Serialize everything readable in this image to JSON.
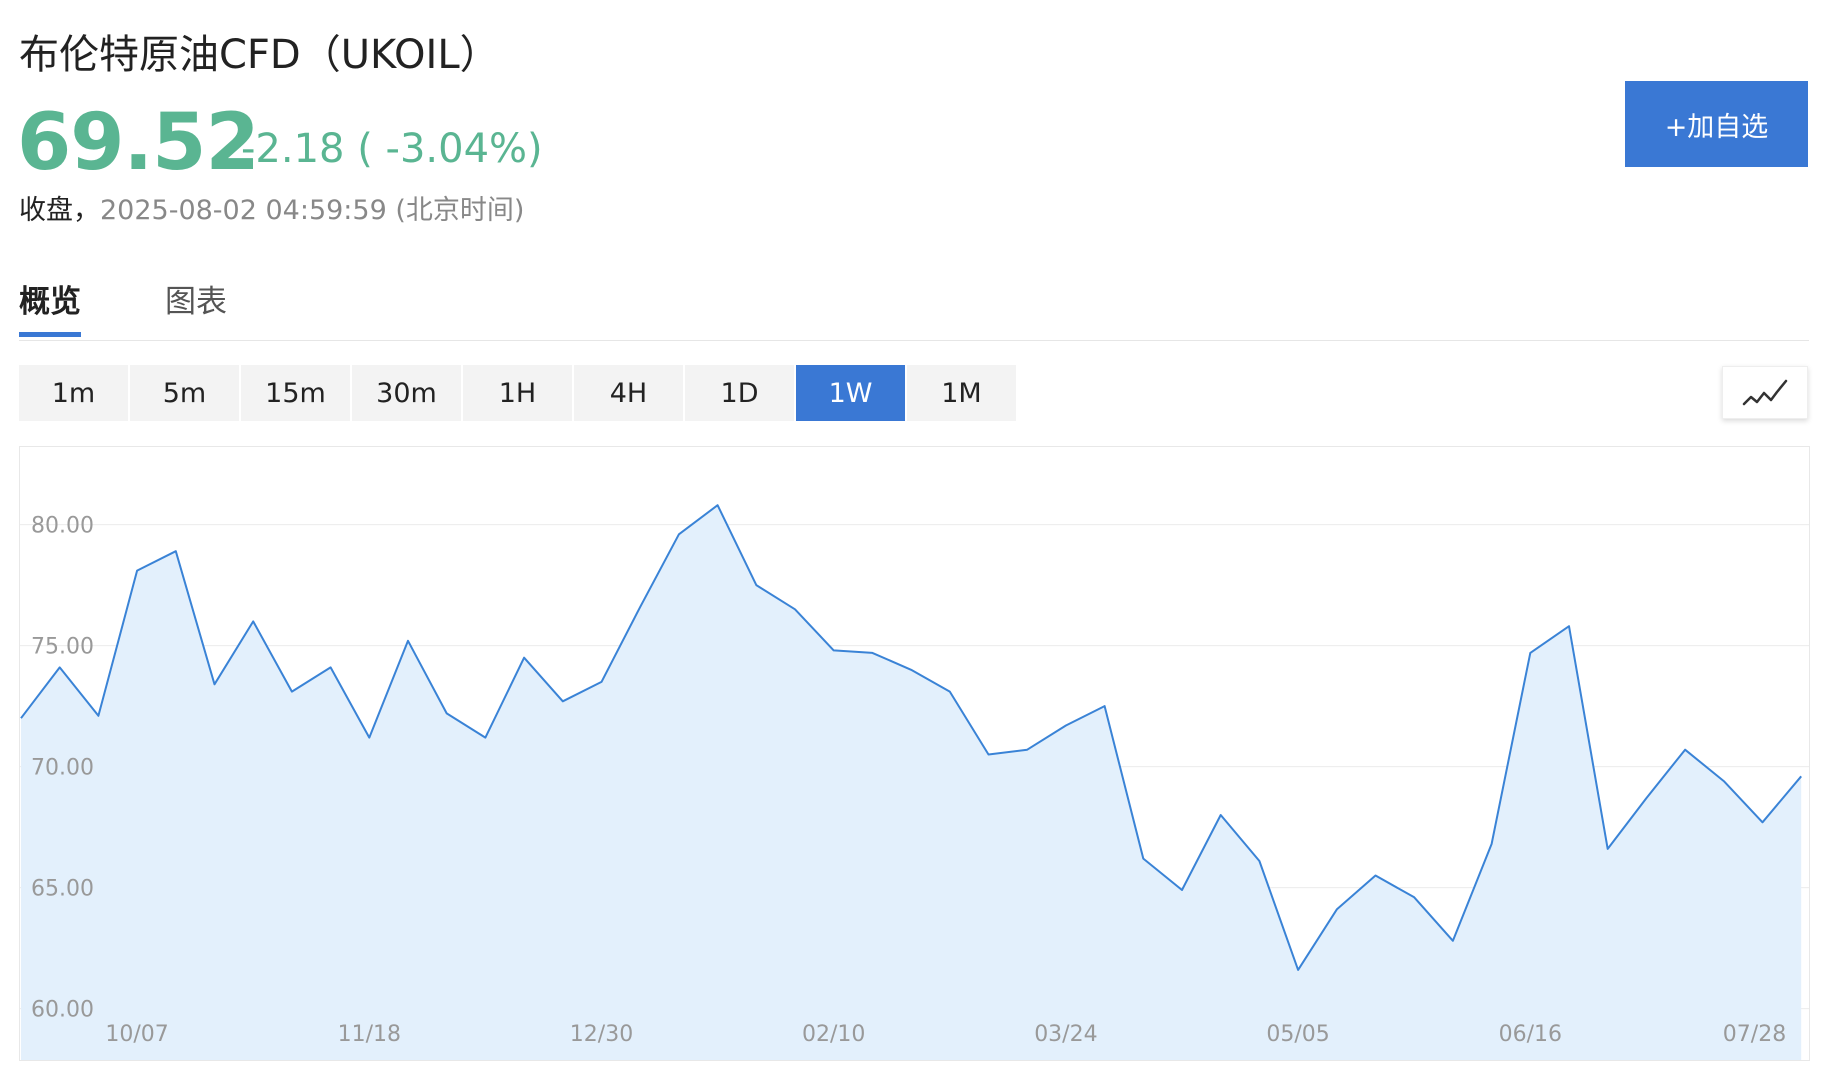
{
  "header": {
    "title": "布伦特原油CFD（UKOIL）",
    "price": "69.52",
    "change": "-2.18 ( -3.04%)",
    "status_label": "收盘，",
    "status_time": "2025-08-02 04:59:59 (北京时间)",
    "watch_button": "+加自选"
  },
  "tabs": [
    {
      "label": "概览",
      "active": true
    },
    {
      "label": "图表",
      "active": false
    }
  ],
  "periods": [
    "1m",
    "5m",
    "15m",
    "30m",
    "1H",
    "4H",
    "1D",
    "1W",
    "1M"
  ],
  "active_period": "1W",
  "chart_type_icon": "line-chart-icon",
  "colors": {
    "accent": "#3a78d4",
    "down": "#5ab592",
    "line": "#3a83d6",
    "fill": "#e3f0fc"
  },
  "chart_data": {
    "type": "area",
    "ylim": [
      58,
      83
    ],
    "yticks": [
      "80.00",
      "75.00",
      "70.00",
      "65.00",
      "60.00"
    ],
    "x_tick_labels": [
      "10/07",
      "11/18",
      "12/30",
      "02/10",
      "03/24",
      "05/05",
      "06/16",
      "07/28"
    ],
    "x_tick_index": [
      3,
      9,
      15,
      21,
      27,
      33,
      39,
      45
    ],
    "series": [
      {
        "values": [
          72.0,
          74.1,
          72.1,
          78.1,
          78.9,
          73.4,
          76.0,
          73.1,
          74.1,
          71.2,
          75.2,
          72.2,
          71.2,
          74.5,
          72.7,
          73.5,
          76.6,
          79.6,
          80.8,
          77.5,
          76.5,
          74.8,
          74.7,
          74.0,
          73.1,
          70.5,
          70.7,
          71.7,
          72.5,
          66.2,
          64.9,
          68.0,
          66.1,
          61.6,
          64.1,
          65.5,
          64.6,
          62.8,
          66.8,
          74.7,
          75.8,
          66.6,
          68.7,
          70.7,
          69.4,
          67.7,
          69.6
        ]
      }
    ]
  }
}
